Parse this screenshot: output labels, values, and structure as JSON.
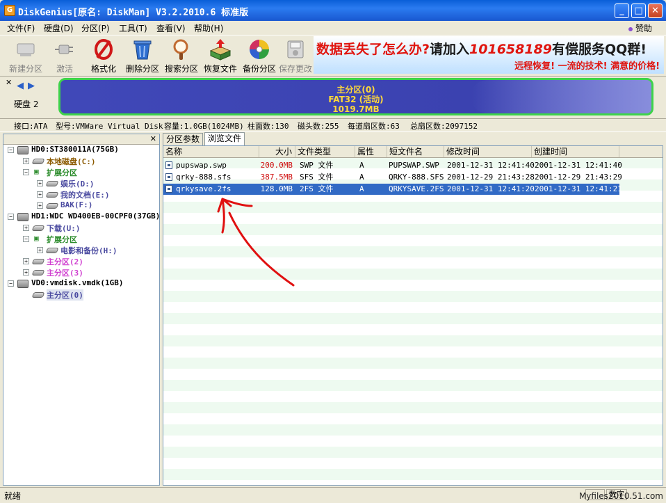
{
  "window": {
    "title": "DiskGenius[原名: DiskMan] V3.2.2010.6 标准版",
    "minimize": "_",
    "maximize": "□",
    "close": "✕"
  },
  "menu": {
    "items": [
      "文件(F)",
      "硬盘(D)",
      "分区(P)",
      "工具(T)",
      "查看(V)",
      "帮助(H)"
    ],
    "sponsor": "赞助"
  },
  "toolbar": {
    "items": [
      {
        "label": "新建分区",
        "icon": "new-partition-icon",
        "enabled": false
      },
      {
        "label": "激活",
        "icon": "activate-plug-icon",
        "enabled": false
      },
      {
        "label": "格式化",
        "icon": "format-icon",
        "enabled": true
      },
      {
        "label": "删除分区",
        "icon": "trash-icon",
        "enabled": true
      },
      {
        "label": "搜索分区",
        "icon": "search-magnifier-icon",
        "enabled": true
      },
      {
        "label": "恢复文件",
        "icon": "recover-box-icon",
        "enabled": true
      },
      {
        "label": "备份分区",
        "icon": "backup-disc-icon",
        "enabled": true
      },
      {
        "label": "保存更改",
        "icon": "save-icon",
        "enabled": false
      }
    ]
  },
  "banner": {
    "part1": "数据丢失了怎么办?",
    "part2": "请加入",
    "qq": "101658189",
    "part3": "有偿服务QQ群!",
    "slogan": "远程恢复! 一流的技术! 满意的价格!"
  },
  "disk": {
    "label": "硬盘 2",
    "partition_name": "主分区(0)",
    "partition_fs": "FAT32 (活动)",
    "partition_size": "1019.7MB"
  },
  "info": {
    "interface": "接口:ATA",
    "model": "型号:VMWare Virtual Disk",
    "capacity": "容量:1.0GB(1024MB)",
    "cylinders": "柱面数:130",
    "heads": "磁头数:255",
    "sectors_per_track": "每道扇区数:63",
    "total_sectors": "总扇区数:2097152"
  },
  "tree": {
    "nodes": [
      {
        "text": "HD0:ST380011A(75GB)",
        "color": "#000000"
      },
      {
        "text": "本地磁盘(C:)",
        "color": "#8b5a00"
      },
      {
        "text": "扩展分区",
        "color": "#2c8c2c"
      },
      {
        "text": "娱乐(D:)",
        "color": "#4a4aa0"
      },
      {
        "text": "我的文档(E:)",
        "color": "#4a4aa0"
      },
      {
        "text": "BAK(F:)",
        "color": "#4a4aa0"
      },
      {
        "text": "HD1:WDC WD400EB-00CPF0(37GB)",
        "color": "#000000"
      },
      {
        "text": "下载(U:)",
        "color": "#4a4aa0"
      },
      {
        "text": "扩展分区",
        "color": "#2c8c2c"
      },
      {
        "text": "电影和备份(H:)",
        "color": "#4a4aa0"
      },
      {
        "text": "主分区(2)",
        "color": "#d040d0"
      },
      {
        "text": "主分区(3)",
        "color": "#d040d0"
      },
      {
        "text": "VD0:vmdisk.vmdk(1GB)",
        "color": "#000000"
      },
      {
        "text": "主分区(0)",
        "color": "#4a4aa0"
      }
    ]
  },
  "tabs": [
    "分区参数",
    "浏览文件"
  ],
  "columns": [
    "名称",
    "大小",
    "文件类型",
    "属性",
    "短文件名",
    "修改时间",
    "创建时间"
  ],
  "files": [
    {
      "name": "pupswap.swp",
      "size": "200.0MB",
      "type": "SWP 文件",
      "attr": "A",
      "short": "PUPSWAP.SWP",
      "modified": "2001-12-31 12:41:40",
      "created": "2001-12-31 12:41:40"
    },
    {
      "name": "qrky-888.sfs",
      "size": "387.5MB",
      "type": "SFS 文件",
      "attr": "A",
      "short": "QRKY-888.SFS",
      "modified": "2001-12-29 21:43:28",
      "created": "2001-12-29 21:43:29"
    },
    {
      "name": "qrkysave.2fs",
      "size": "128.0MB",
      "type": "2FS 文件",
      "attr": "A",
      "short": "QRKYSAVE.2FS",
      "modified": "2001-12-31 12:41:20",
      "created": "2001-12-31 12:41:21"
    }
  ],
  "colors": {
    "partition_fill": "#3b42b0",
    "partition_border": "#3ed34a",
    "selection": "#316ac5",
    "annotation_arrow": "#e01010"
  },
  "status": {
    "text": "就绪",
    "numlock": "数字",
    "watermark": "Myfiles2010.51.com"
  }
}
